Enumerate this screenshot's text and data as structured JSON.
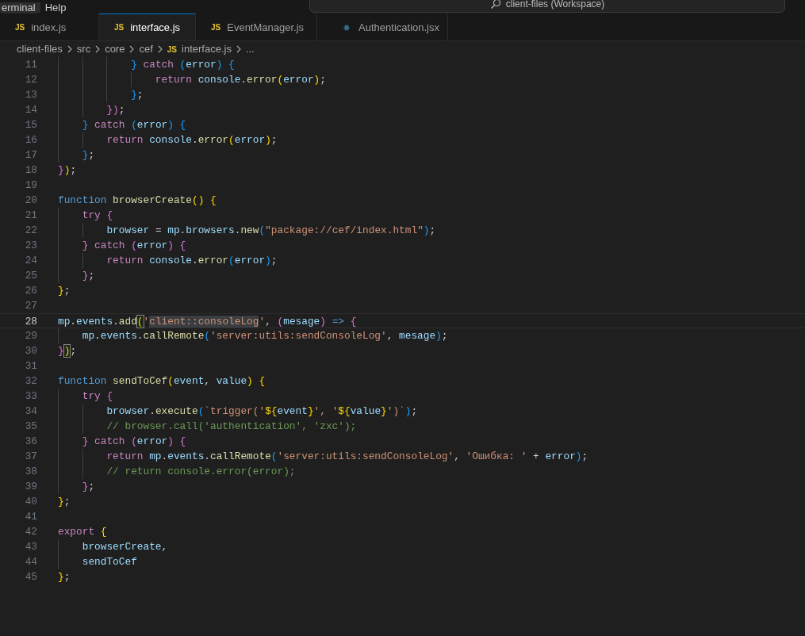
{
  "menu_bar": {
    "items": [
      {
        "label": "erminal",
        "selected": true
      },
      {
        "label": "Help",
        "selected": false
      }
    ],
    "search": {
      "placeholder": "client-files (Workspace)"
    }
  },
  "tabs": [
    {
      "label": "index.js",
      "kind": "js",
      "badge": "JS",
      "selected": false
    },
    {
      "label": "interface.js",
      "kind": "js",
      "badge": "JS",
      "selected": true
    },
    {
      "label": "EventManager.js",
      "kind": "js",
      "badge": "JS",
      "selected": false
    },
    {
      "label": "Authentication.jsx",
      "kind": "react",
      "selected": false
    }
  ],
  "breadcrumbs": [
    {
      "label": "client-files"
    },
    {
      "label": "src"
    },
    {
      "label": "core"
    },
    {
      "label": "cef"
    },
    {
      "label": "interface.js",
      "badge": "JS"
    },
    {
      "label": "..."
    }
  ],
  "lines": [
    {
      "number": "11",
      "current": false,
      "tokens": [
        {
          "text": "            }",
          "kind": "bracket3"
        },
        {
          "text": " catch",
          "kind": "keyword"
        },
        {
          "text": " (",
          "kind": "bracket3"
        },
        {
          "text": "error",
          "kind": "variable"
        },
        {
          "text": ")",
          "kind": "bracket3"
        },
        {
          "text": " {",
          "kind": "bracket3"
        }
      ]
    },
    {
      "number": "12",
      "current": false,
      "tokens": [
        {
          "text": "                return",
          "kind": "keyword"
        },
        {
          "text": " console",
          "kind": "variable"
        },
        {
          "text": ".",
          "kind": "plain"
        },
        {
          "text": "error",
          "kind": "function"
        },
        {
          "text": "(",
          "kind": "bracket1"
        },
        {
          "text": "error",
          "kind": "variable"
        },
        {
          "text": ")",
          "kind": "bracket1"
        },
        {
          "text": ";",
          "kind": "plain"
        }
      ]
    },
    {
      "number": "13",
      "current": false,
      "tokens": [
        {
          "text": "            }",
          "kind": "bracket3"
        },
        {
          "text": ";",
          "kind": "plain"
        }
      ]
    },
    {
      "number": "14",
      "current": false,
      "tokens": [
        {
          "text": "        })",
          "kind": "bracket2"
        },
        {
          "text": ";",
          "kind": "plain"
        }
      ]
    },
    {
      "number": "15",
      "current": false,
      "tokens": [
        {
          "text": "    }",
          "kind": "bracket3"
        },
        {
          "text": " catch",
          "kind": "keyword"
        },
        {
          "text": " (",
          "kind": "bracket3"
        },
        {
          "text": "error",
          "kind": "variable"
        },
        {
          "text": ")",
          "kind": "bracket3"
        },
        {
          "text": " {",
          "kind": "bracket3"
        }
      ]
    },
    {
      "number": "16",
      "current": false,
      "tokens": [
        {
          "text": "        return",
          "kind": "keyword"
        },
        {
          "text": " console",
          "kind": "variable"
        },
        {
          "text": ".",
          "kind": "plain"
        },
        {
          "text": "error",
          "kind": "function"
        },
        {
          "text": "(",
          "kind": "bracket1"
        },
        {
          "text": "error",
          "kind": "variable"
        },
        {
          "text": ")",
          "kind": "bracket1"
        },
        {
          "text": ";",
          "kind": "plain"
        }
      ]
    },
    {
      "number": "17",
      "current": false,
      "tokens": [
        {
          "text": "    }",
          "kind": "bracket3"
        },
        {
          "text": ";",
          "kind": "plain"
        }
      ]
    },
    {
      "number": "18",
      "current": false,
      "tokens": [
        {
          "text": "}",
          "kind": "bracket2"
        },
        {
          "text": ")",
          "kind": "bracket1"
        },
        {
          "text": ";",
          "kind": "plain"
        }
      ]
    },
    {
      "number": "19",
      "current": false
    },
    {
      "number": "20",
      "current": false,
      "tokens": [
        {
          "text": "function",
          "kind": "storage"
        },
        {
          "text": " browserCreate",
          "kind": "function"
        },
        {
          "text": "()",
          "kind": "bracket1"
        },
        {
          "text": " {",
          "kind": "bracket1"
        }
      ]
    },
    {
      "number": "21",
      "current": false,
      "tokens": [
        {
          "text": "    try",
          "kind": "keyword"
        },
        {
          "text": " {",
          "kind": "bracket2"
        }
      ]
    },
    {
      "number": "22",
      "current": false,
      "tokens": [
        {
          "text": "        browser",
          "kind": "variable"
        },
        {
          "text": " =",
          "kind": "plain"
        },
        {
          "text": " mp",
          "kind": "variable"
        },
        {
          "text": ".",
          "kind": "plain"
        },
        {
          "text": "browsers",
          "kind": "variable"
        },
        {
          "text": ".",
          "kind": "plain"
        },
        {
          "text": "new",
          "kind": "function"
        },
        {
          "text": "(",
          "kind": "bracket3"
        },
        {
          "text": "\"package://cef/index.html\"",
          "kind": "string"
        },
        {
          "text": ")",
          "kind": "bracket3"
        },
        {
          "text": ";",
          "kind": "plain"
        }
      ]
    },
    {
      "number": "23",
      "current": false,
      "tokens": [
        {
          "text": "    }",
          "kind": "bracket2"
        },
        {
          "text": " catch",
          "kind": "keyword"
        },
        {
          "text": " (",
          "kind": "bracket2"
        },
        {
          "text": "error",
          "kind": "variable"
        },
        {
          "text": ")",
          "kind": "bracket2"
        },
        {
          "text": " {",
          "kind": "bracket2"
        }
      ]
    },
    {
      "number": "24",
      "current": false,
      "tokens": [
        {
          "text": "        return",
          "kind": "keyword"
        },
        {
          "text": " console",
          "kind": "variable"
        },
        {
          "text": ".",
          "kind": "plain"
        },
        {
          "text": "error",
          "kind": "function"
        },
        {
          "text": "(",
          "kind": "bracket3"
        },
        {
          "text": "error",
          "kind": "variable"
        },
        {
          "text": ")",
          "kind": "bracket3"
        },
        {
          "text": ";",
          "kind": "plain"
        }
      ]
    },
    {
      "number": "25",
      "current": false,
      "tokens": [
        {
          "text": "    }",
          "kind": "bracket2"
        },
        {
          "text": ";",
          "kind": "plain"
        }
      ]
    },
    {
      "number": "26",
      "current": false,
      "tokens": [
        {
          "text": "}",
          "kind": "bracket1"
        },
        {
          "text": ";",
          "kind": "plain"
        }
      ]
    },
    {
      "number": "27",
      "current": false
    },
    {
      "number": "28",
      "current": true,
      "tokens": [
        {
          "text": "mp",
          "kind": "variable"
        },
        {
          "text": ".",
          "kind": "plain"
        },
        {
          "text": "events",
          "kind": "variable"
        },
        {
          "text": ".",
          "kind": "plain"
        },
        {
          "text": "add",
          "kind": "function"
        },
        {
          "text": "(",
          "kind": "bracket1",
          "matched": true
        },
        {
          "text": "'",
          "kind": "string"
        },
        {
          "text": "client::consoleLog",
          "kind": "string",
          "highlight": true
        },
        {
          "text": "'",
          "kind": "string"
        },
        {
          "text": ",",
          "kind": "plain"
        },
        {
          "text": " (",
          "kind": "bracket2"
        },
        {
          "text": "mesage",
          "kind": "variable"
        },
        {
          "text": ")",
          "kind": "bracket2"
        },
        {
          "text": " =>",
          "kind": "storage"
        },
        {
          "text": " {",
          "kind": "bracket2"
        }
      ]
    },
    {
      "number": "29",
      "current": false,
      "tokens": [
        {
          "text": "    mp",
          "kind": "variable"
        },
        {
          "text": ".",
          "kind": "plain"
        },
        {
          "text": "events",
          "kind": "variable"
        },
        {
          "text": ".",
          "kind": "plain"
        },
        {
          "text": "callRemote",
          "kind": "function"
        },
        {
          "text": "(",
          "kind": "bracket3"
        },
        {
          "text": "'server:utils:sendConsoleLog'",
          "kind": "string"
        },
        {
          "text": ",",
          "kind": "plain"
        },
        {
          "text": " mesage",
          "kind": "variable"
        },
        {
          "text": ")",
          "kind": "bracket3"
        },
        {
          "text": ";",
          "kind": "plain"
        }
      ]
    },
    {
      "number": "30",
      "current": false,
      "tokens": [
        {
          "text": "}",
          "kind": "bracket2"
        },
        {
          "text": ")",
          "kind": "bracket1",
          "matched": true
        },
        {
          "text": ";",
          "kind": "plain"
        }
      ]
    },
    {
      "number": "31",
      "current": false
    },
    {
      "number": "32",
      "current": false,
      "tokens": [
        {
          "text": "function",
          "kind": "storage"
        },
        {
          "text": " sendToCef",
          "kind": "function"
        },
        {
          "text": "(",
          "kind": "bracket1"
        },
        {
          "text": "event",
          "kind": "variable"
        },
        {
          "text": ",",
          "kind": "plain"
        },
        {
          "text": " value",
          "kind": "variable"
        },
        {
          "text": ")",
          "kind": "bracket1"
        },
        {
          "text": " {",
          "kind": "bracket1"
        }
      ]
    },
    {
      "number": "33",
      "current": false,
      "tokens": [
        {
          "text": "    try",
          "kind": "keyword"
        },
        {
          "text": " {",
          "kind": "bracket2"
        }
      ]
    },
    {
      "number": "34",
      "current": false,
      "tokens": [
        {
          "text": "        browser",
          "kind": "variable"
        },
        {
          "text": ".",
          "kind": "plain"
        },
        {
          "text": "execute",
          "kind": "function"
        },
        {
          "text": "(",
          "kind": "bracket3"
        },
        {
          "text": "`trigger('",
          "kind": "string"
        },
        {
          "text": "${",
          "kind": "bracket1"
        },
        {
          "text": "event",
          "kind": "variable"
        },
        {
          "text": "}",
          "kind": "bracket1"
        },
        {
          "text": "', '",
          "kind": "string"
        },
        {
          "text": "${",
          "kind": "bracket1"
        },
        {
          "text": "value",
          "kind": "variable"
        },
        {
          "text": "}",
          "kind": "bracket1"
        },
        {
          "text": "')`",
          "kind": "string"
        },
        {
          "text": ")",
          "kind": "bracket3"
        },
        {
          "text": ";",
          "kind": "plain"
        }
      ]
    },
    {
      "number": "35",
      "current": false,
      "tokens": [
        {
          "text": "        // browser.call('authentication', 'zxc');",
          "kind": "comment"
        }
      ]
    },
    {
      "number": "36",
      "current": false,
      "tokens": [
        {
          "text": "    }",
          "kind": "bracket2"
        },
        {
          "text": " catch",
          "kind": "keyword"
        },
        {
          "text": " (",
          "kind": "bracket2"
        },
        {
          "text": "error",
          "kind": "variable"
        },
        {
          "text": ")",
          "kind": "bracket2"
        },
        {
          "text": " {",
          "kind": "bracket2"
        }
      ]
    },
    {
      "number": "37",
      "current": false,
      "tokens": [
        {
          "text": "        return",
          "kind": "keyword"
        },
        {
          "text": " mp",
          "kind": "variable"
        },
        {
          "text": ".",
          "kind": "plain"
        },
        {
          "text": "events",
          "kind": "variable"
        },
        {
          "text": ".",
          "kind": "plain"
        },
        {
          "text": "callRemote",
          "kind": "function"
        },
        {
          "text": "(",
          "kind": "bracket3"
        },
        {
          "text": "'server:utils:sendConsoleLog'",
          "kind": "string"
        },
        {
          "text": ",",
          "kind": "plain"
        },
        {
          "text": " 'Ошибка: '",
          "kind": "string"
        },
        {
          "text": " +",
          "kind": "plain"
        },
        {
          "text": " error",
          "kind": "variable"
        },
        {
          "text": ")",
          "kind": "bracket3"
        },
        {
          "text": ";",
          "kind": "plain"
        }
      ]
    },
    {
      "number": "38",
      "current": false,
      "tokens": [
        {
          "text": "        // return console.error(error);",
          "kind": "comment"
        }
      ]
    },
    {
      "number": "39",
      "current": false,
      "tokens": [
        {
          "text": "    }",
          "kind": "bracket2"
        },
        {
          "text": ";",
          "kind": "plain"
        }
      ]
    },
    {
      "number": "40",
      "current": false,
      "tokens": [
        {
          "text": "}",
          "kind": "bracket1"
        },
        {
          "text": ";",
          "kind": "plain"
        }
      ]
    },
    {
      "number": "41",
      "current": false
    },
    {
      "number": "42",
      "current": false,
      "tokens": [
        {
          "text": "export",
          "kind": "keyword"
        },
        {
          "text": " {",
          "kind": "bracket1"
        }
      ]
    },
    {
      "number": "43",
      "current": false,
      "tokens": [
        {
          "text": "    browserCreate",
          "kind": "variable"
        },
        {
          "text": ",",
          "kind": "plain"
        }
      ]
    },
    {
      "number": "44",
      "current": false,
      "tokens": [
        {
          "text": "    sendToCef",
          "kind": "variable"
        }
      ]
    },
    {
      "number": "45",
      "current": false,
      "tokens": [
        {
          "text": "}",
          "kind": "bracket1"
        },
        {
          "text": ";",
          "kind": "plain"
        }
      ]
    }
  ]
}
